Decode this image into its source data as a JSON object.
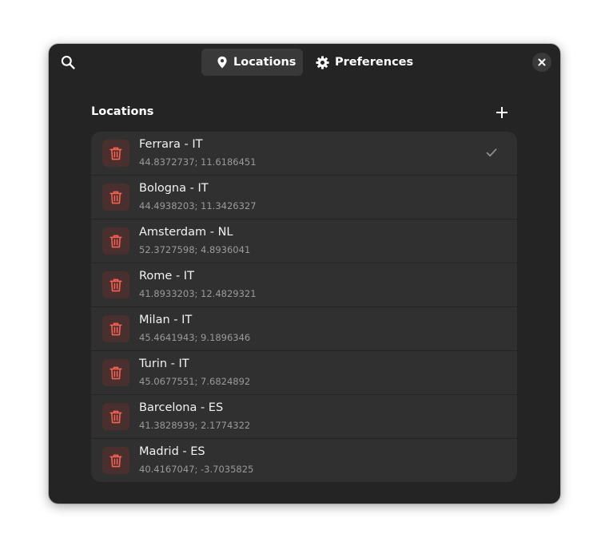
{
  "header": {
    "tabs": [
      {
        "label": "Locations",
        "icon": "map-pin-icon",
        "active": true
      },
      {
        "label": "Preferences",
        "icon": "gear-icon",
        "active": false
      }
    ],
    "search_icon": "search-icon",
    "close_icon": "close-icon"
  },
  "locations": {
    "title": "Locations",
    "add_icon": "plus-icon",
    "items": [
      {
        "name": "Ferrara - IT",
        "coords": "44.8372737; 11.6186451",
        "selected": true
      },
      {
        "name": "Bologna - IT",
        "coords": "44.4938203; 11.3426327",
        "selected": false
      },
      {
        "name": "Amsterdam - NL",
        "coords": "52.3727598; 4.8936041",
        "selected": false
      },
      {
        "name": "Rome - IT",
        "coords": "41.8933203; 12.4829321",
        "selected": false
      },
      {
        "name": "Milan - IT",
        "coords": "45.4641943; 9.1896346",
        "selected": false
      },
      {
        "name": "Turin - IT",
        "coords": "45.0677551; 7.6824892",
        "selected": false
      },
      {
        "name": "Barcelona - ES",
        "coords": "41.3828939; 2.1774322",
        "selected": false
      },
      {
        "name": "Madrid - ES",
        "coords": "40.4167047; -3.7035825",
        "selected": false
      }
    ]
  },
  "colors": {
    "window_bg": "#242424",
    "list_bg": "#303030",
    "destructive": "#f66151",
    "destructive_bg": "#4a2f2f",
    "check": "#8e8e8e"
  }
}
